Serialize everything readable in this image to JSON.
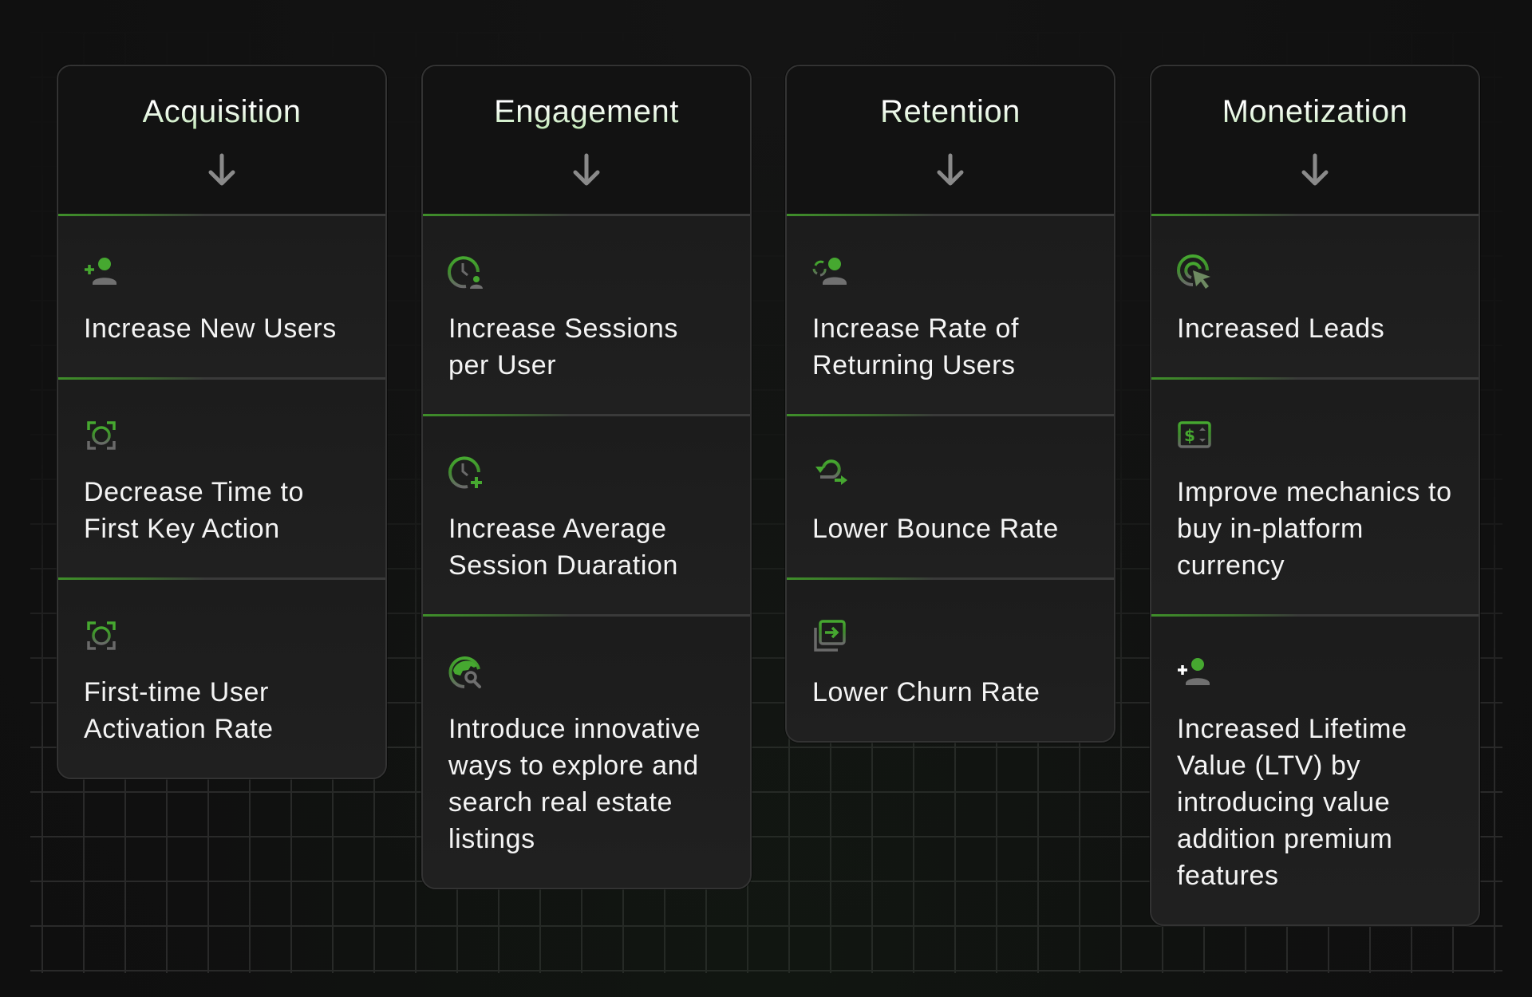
{
  "columns": [
    {
      "title": "Acquisition",
      "header_icon": "arrow-down-icon",
      "items": [
        {
          "icon": "person-add-icon",
          "text": "Increase New Users"
        },
        {
          "icon": "face-scan-icon",
          "text": "Decrease Time to First Key Action"
        },
        {
          "icon": "face-scan-icon",
          "text": "First-time User Activation Rate"
        }
      ]
    },
    {
      "title": "Engagement",
      "header_icon": "arrow-down-icon",
      "items": [
        {
          "icon": "clock-user-icon",
          "text": "Increase Sessions per User"
        },
        {
          "icon": "clock-add-icon",
          "text": "Increase Average Session Duaration"
        },
        {
          "icon": "globe-search-icon",
          "text": "Introduce innovative ways to explore and search real estate listings"
        }
      ]
    },
    {
      "title": "Retention",
      "header_icon": "arrow-down-icon",
      "items": [
        {
          "icon": "recycle-user-icon",
          "text": "Increase Rate of Returning Users"
        },
        {
          "icon": "bounce-arrow-icon",
          "text": "Lower Bounce Rate"
        },
        {
          "icon": "exit-stack-icon",
          "text": "Lower Churn Rate"
        }
      ]
    },
    {
      "title": "Monetization",
      "header_icon": "arrow-down-icon",
      "items": [
        {
          "icon": "target-cursor-icon",
          "text": "Increased Leads"
        },
        {
          "icon": "currency-exchange-icon",
          "text": "Improve mechanics to buy in-platform currency"
        },
        {
          "icon": "person-add-icon",
          "text": "Increased Lifetime Value (LTV) by introducing value addition premium features"
        }
      ]
    }
  ],
  "colors": {
    "accent_green": "#3f9a2c",
    "icon_gray": "#6e6e6e",
    "header_bg": "#121212",
    "body_bg": "#1e1e1e",
    "border": "#333333",
    "arrow_gray": "#8a8a8a",
    "text": "#f4f4f4"
  }
}
